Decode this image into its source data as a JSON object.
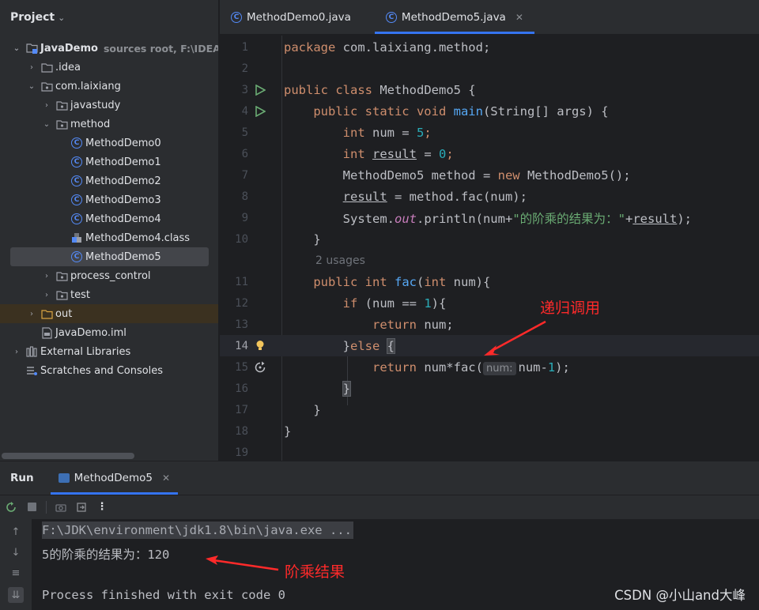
{
  "project": {
    "title": "Project",
    "tree": [
      {
        "label": "JavaDemo",
        "hint": "sources root,  F:\\IDEA_co",
        "icon": "module-folder-icon",
        "arrow": "⌄",
        "indent": 0,
        "bold": true
      },
      {
        "label": ".idea",
        "icon": "folder-icon",
        "arrow": "›",
        "indent": 1
      },
      {
        "label": "com.laixiang",
        "icon": "package-icon",
        "arrow": "⌄",
        "indent": 1
      },
      {
        "label": "javastudy",
        "icon": "package-icon",
        "arrow": "›",
        "indent": 2
      },
      {
        "label": "method",
        "icon": "package-icon",
        "arrow": "⌄",
        "indent": 2
      },
      {
        "label": "MethodDemo0",
        "icon": "java-class-icon",
        "arrow": "",
        "indent": 3
      },
      {
        "label": "MethodDemo1",
        "icon": "java-class-icon",
        "arrow": "",
        "indent": 3
      },
      {
        "label": "MethodDemo2",
        "icon": "java-class-icon",
        "arrow": "",
        "indent": 3
      },
      {
        "label": "MethodDemo3",
        "icon": "java-class-icon",
        "arrow": "",
        "indent": 3
      },
      {
        "label": "MethodDemo4",
        "icon": "java-class-icon",
        "arrow": "",
        "indent": 3
      },
      {
        "label": "MethodDemo4.class",
        "icon": "class-file-icon",
        "arrow": "",
        "indent": 3
      },
      {
        "label": "MethodDemo5",
        "icon": "java-class-icon",
        "arrow": "",
        "indent": 3,
        "selected": true
      },
      {
        "label": "process_control",
        "icon": "package-icon",
        "arrow": "›",
        "indent": 2
      },
      {
        "label": "test",
        "icon": "package-icon",
        "arrow": "›",
        "indent": 2
      },
      {
        "label": "out",
        "icon": "excluded-folder-icon",
        "arrow": "›",
        "indent": 1,
        "out": true
      },
      {
        "label": "JavaDemo.iml",
        "icon": "iml-file-icon",
        "arrow": "",
        "indent": 1
      },
      {
        "label": "External Libraries",
        "icon": "libraries-icon",
        "arrow": "›",
        "indent": 0
      },
      {
        "label": "Scratches and Consoles",
        "icon": "scratches-icon",
        "arrow": "",
        "indent": 0
      }
    ]
  },
  "editor": {
    "tabs": [
      {
        "label": "MethodDemo0.java",
        "active": false
      },
      {
        "label": "MethodDemo5.java",
        "active": true
      }
    ],
    "lines": [
      {
        "n": "1",
        "tokens": [
          [
            "kw",
            "package "
          ],
          [
            "",
            "com.laixiang.method;"
          ]
        ]
      },
      {
        "n": "2",
        "tokens": []
      },
      {
        "n": "3",
        "gutter": "run",
        "tokens": [
          [
            "kw",
            "public class "
          ],
          [
            "",
            "MethodDemo5 {"
          ]
        ]
      },
      {
        "n": "4",
        "gutter": "run",
        "tokens": [
          [
            "",
            "    "
          ],
          [
            "kw",
            "public static void "
          ],
          [
            "fn",
            "main"
          ],
          [
            "",
            "(String[] args) {"
          ]
        ]
      },
      {
        "n": "5",
        "tokens": [
          [
            "",
            "        "
          ],
          [
            "kw",
            "int "
          ],
          [
            "",
            "num = "
          ],
          [
            "num",
            "5"
          ],
          [
            "kw",
            ";"
          ]
        ]
      },
      {
        "n": "6",
        "tokens": [
          [
            "",
            "        "
          ],
          [
            "kw",
            "int "
          ],
          [
            "ul",
            "result"
          ],
          [
            "",
            " = "
          ],
          [
            "num",
            "0"
          ],
          [
            "kw",
            ";"
          ]
        ]
      },
      {
        "n": "7",
        "tokens": [
          [
            "",
            "        MethodDemo5 method = "
          ],
          [
            "kw",
            "new "
          ],
          [
            "",
            "MethodDemo5();"
          ]
        ]
      },
      {
        "n": "8",
        "tokens": [
          [
            "",
            "        "
          ],
          [
            "ul",
            "result"
          ],
          [
            "",
            " = method.fac(num);"
          ]
        ]
      },
      {
        "n": "9",
        "tokens": [
          [
            "",
            "        System."
          ],
          [
            "ital",
            "out"
          ],
          [
            "",
            ".println(num+"
          ],
          [
            "str",
            "\"的阶乘的结果为：\""
          ],
          [
            "",
            "+"
          ],
          [
            "ul",
            "result"
          ],
          [
            "",
            ");"
          ]
        ]
      },
      {
        "n": "10",
        "tokens": [
          [
            "",
            "    }"
          ]
        ]
      },
      {
        "n": "",
        "usages": "2 usages"
      },
      {
        "n": "11",
        "tokens": [
          [
            "",
            "    "
          ],
          [
            "kw",
            "public int "
          ],
          [
            "fn",
            "fac"
          ],
          [
            "",
            "("
          ],
          [
            "kw",
            "int "
          ],
          [
            "",
            "num){"
          ]
        ]
      },
      {
        "n": "12",
        "tokens": [
          [
            "",
            "        "
          ],
          [
            "kw",
            "if "
          ],
          [
            "",
            "(num == "
          ],
          [
            "num",
            "1"
          ],
          [
            "",
            "){"
          ]
        ]
      },
      {
        "n": "13",
        "tokens": [
          [
            "",
            "            "
          ],
          [
            "kw",
            "return "
          ],
          [
            "",
            "num;"
          ]
        ]
      },
      {
        "n": "14",
        "gutter": "bulb",
        "current": true,
        "tokens": [
          [
            "",
            "        }"
          ],
          [
            "kw",
            "else "
          ],
          [
            "hl",
            "{"
          ]
        ]
      },
      {
        "n": "15",
        "gutter": "recursive",
        "tokens": [
          [
            "",
            "            "
          ],
          [
            "kw",
            "return "
          ],
          [
            "",
            "num*fac("
          ],
          [
            "inlay",
            "num:"
          ],
          [
            "",
            "num-"
          ],
          [
            "num",
            "1"
          ],
          [
            "",
            ");"
          ]
        ]
      },
      {
        "n": "16",
        "tokens": [
          [
            "",
            "        "
          ],
          [
            "hl",
            "}"
          ]
        ]
      },
      {
        "n": "17",
        "tokens": [
          [
            "",
            "    }"
          ]
        ]
      },
      {
        "n": "18",
        "tokens": [
          [
            "",
            "}"
          ]
        ]
      },
      {
        "n": "19",
        "tokens": []
      }
    ],
    "annotation_recursive": "递归调用"
  },
  "run": {
    "title": "Run",
    "tab": "MethodDemo5",
    "console": {
      "command": "F:\\JDK\\environment\\jdk1.8\\bin\\java.exe ...",
      "output": "5的阶乘的结果为：120",
      "exit": "Process finished with exit code 0"
    },
    "annotation_result": "阶乘结果"
  },
  "watermark": "CSDN @小山and大峰",
  "colors": {
    "accent": "#3574f0",
    "annotation": "#ff2a2a",
    "keyword": "#cf8e6d",
    "number": "#2aacb8",
    "string": "#6aab73",
    "function": "#56a8f5"
  }
}
